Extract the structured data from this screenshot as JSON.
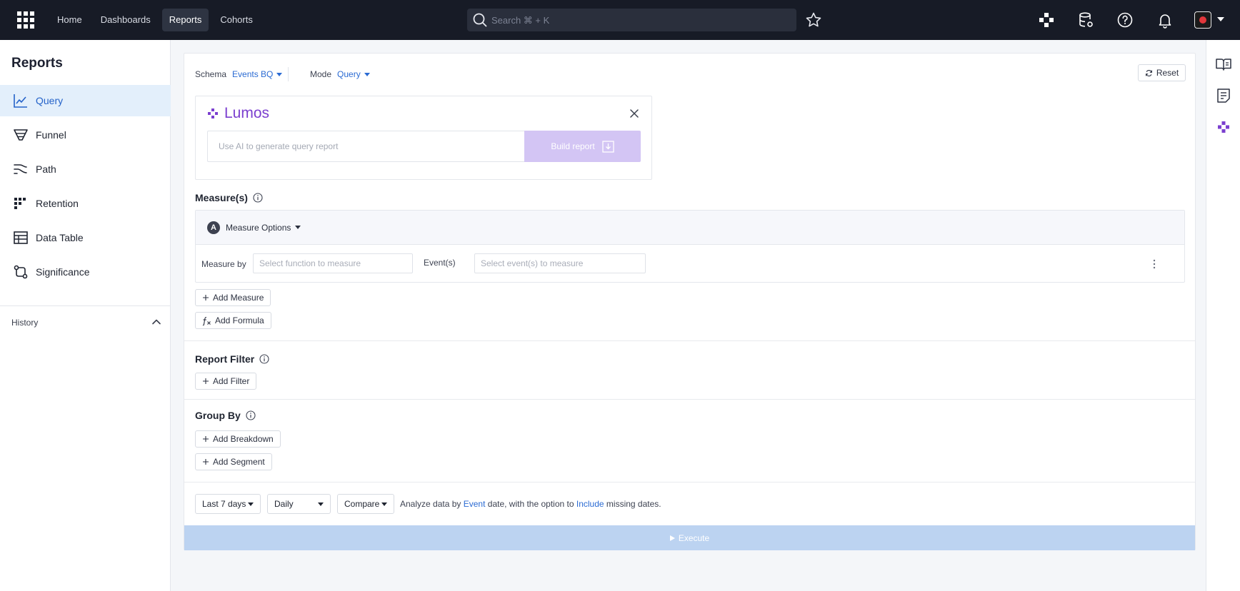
{
  "nav": {
    "links": [
      "Home",
      "Dashboards",
      "Reports",
      "Cohorts"
    ],
    "active": "Reports",
    "search_placeholder": "Search ⌘ + K"
  },
  "sidebar": {
    "title": "Reports",
    "items": [
      {
        "label": "Query",
        "icon": "line-chart-icon",
        "active": true
      },
      {
        "label": "Funnel",
        "icon": "funnel-icon"
      },
      {
        "label": "Path",
        "icon": "path-icon"
      },
      {
        "label": "Retention",
        "icon": "retention-grid-icon"
      },
      {
        "label": "Data Table",
        "icon": "table-icon"
      },
      {
        "label": "Significance",
        "icon": "significance-icon"
      }
    ],
    "history_label": "History"
  },
  "toolbar": {
    "schema_label": "Schema",
    "schema_value": "Events BQ",
    "mode_label": "Mode",
    "mode_value": "Query",
    "reset_label": "Reset"
  },
  "lumos": {
    "brand": "Lumos",
    "input_placeholder": "Use AI to generate query report",
    "build_label": "Build report"
  },
  "measures": {
    "title": "Measure(s)",
    "badge": "A",
    "options_label": "Measure Options",
    "measure_by_label": "Measure by",
    "measure_by_placeholder": "Select function to measure",
    "events_label": "Event(s)",
    "events_placeholder": "Select event(s) to measure",
    "add_measure": "Add Measure",
    "add_formula": "Add Formula"
  },
  "report_filter": {
    "title": "Report Filter",
    "add_filter": "Add Filter"
  },
  "group_by": {
    "title": "Group By",
    "add_breakdown": "Add Breakdown",
    "add_segment": "Add Segment"
  },
  "footer": {
    "range": "Last 7 days",
    "interval": "Daily",
    "compare": "Compare",
    "analyze_prefix": "Analyze data by",
    "analyze_event": "Event",
    "analyze_middle": "date, with the option to",
    "analyze_include": "Include",
    "analyze_suffix": "missing dates.",
    "execute_label": "Execute"
  },
  "colors": {
    "accent": "#2b6bd3",
    "lumos_purple": "#7b3fcf",
    "topbar": "#171b26"
  }
}
